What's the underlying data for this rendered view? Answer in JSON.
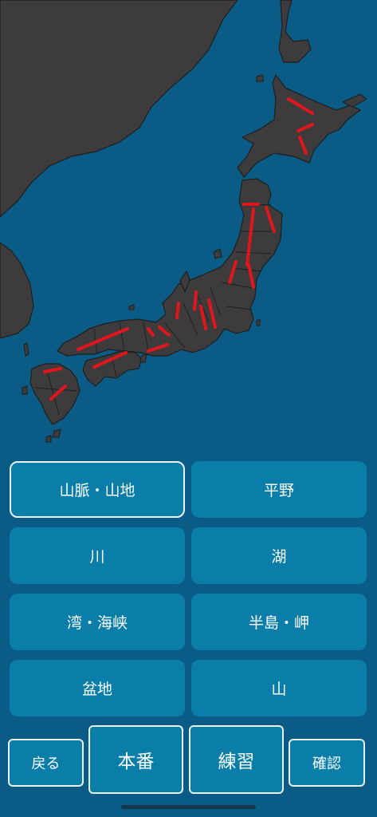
{
  "categories": [
    {
      "label": "山脈・山地",
      "selected": true
    },
    {
      "label": "平野",
      "selected": false
    },
    {
      "label": "川",
      "selected": false
    },
    {
      "label": "湖",
      "selected": false
    },
    {
      "label": "湾・海峡",
      "selected": false
    },
    {
      "label": "半島・岬",
      "selected": false
    },
    {
      "label": "盆地",
      "selected": false
    },
    {
      "label": "山",
      "selected": false
    }
  ],
  "bottom_bar": {
    "back_label": "戻る",
    "real_label": "本番",
    "practice_label": "練習",
    "confirm_label": "確認"
  },
  "colors": {
    "ocean": "#0a5c86",
    "land": "#3d3b3c",
    "border": "#1e1e1e",
    "highlight": "#e0161c",
    "button": "#0a7ea8",
    "button_border": "#e9f2f6"
  }
}
